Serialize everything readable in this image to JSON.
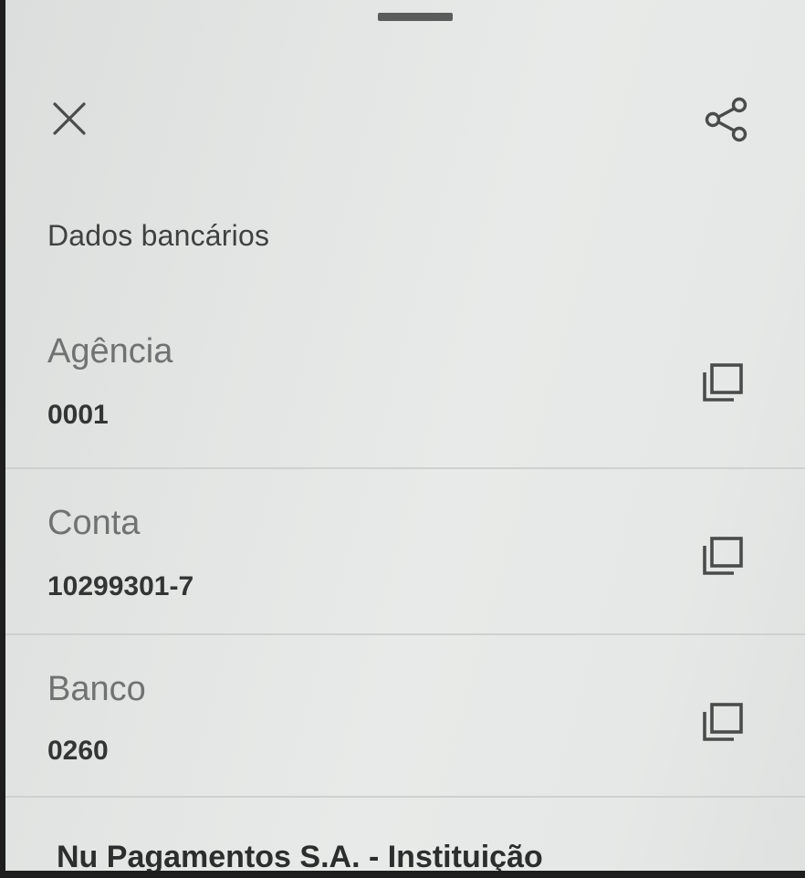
{
  "sheet": {
    "close_icon": "close-icon",
    "share_icon": "share-icon",
    "section_title": "Dados bancários"
  },
  "rows": [
    {
      "label": "Agência",
      "value": "0001",
      "copy_icon": "copy-icon"
    },
    {
      "label": "Conta",
      "value": "10299301-7",
      "copy_icon": "copy-icon"
    },
    {
      "label": "Banco",
      "value": "0260",
      "copy_icon": "copy-icon"
    }
  ],
  "bank_name": "Nu Pagamentos S.A. - Instituição",
  "colors": {
    "background": "#e3e5e4",
    "icon": "#4a4c4c",
    "value_text": "#333535",
    "label_text": "#707272"
  }
}
